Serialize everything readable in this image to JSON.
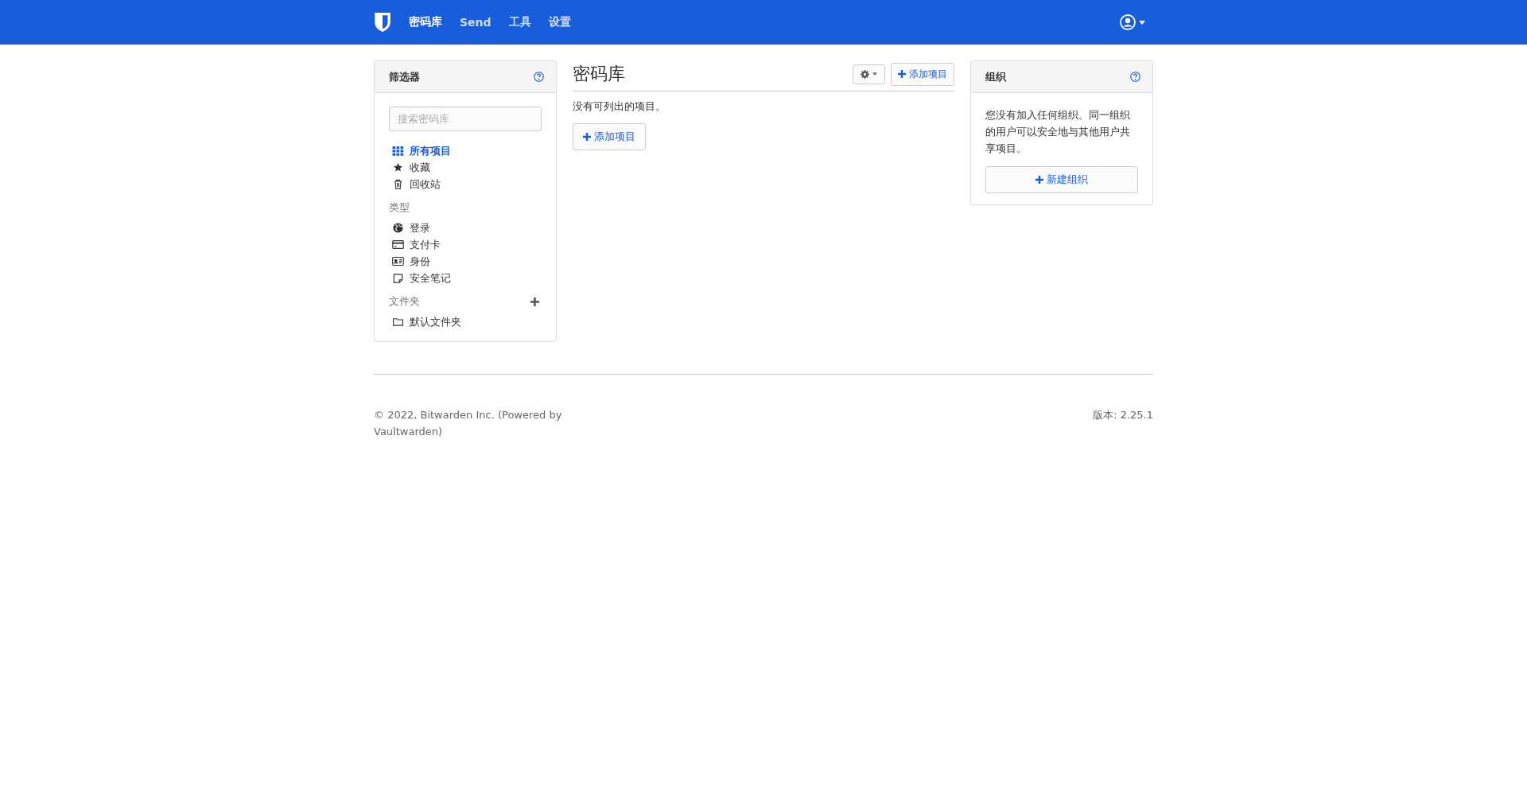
{
  "navbar": {
    "links": [
      {
        "label": "密码库",
        "selected": true
      },
      {
        "label": "Send",
        "selected": false
      },
      {
        "label": "工具",
        "selected": false
      },
      {
        "label": "设置",
        "selected": false
      }
    ]
  },
  "filters": {
    "title": "筛选器",
    "search": {
      "placeholder": "搜索密码库"
    },
    "items": [
      {
        "label": "所有项目",
        "kind": "grid",
        "selected": true
      },
      {
        "label": "收藏",
        "kind": "star",
        "selected": false
      },
      {
        "label": "回收站",
        "kind": "trash",
        "selected": false
      }
    ],
    "types_heading": "类型",
    "types": [
      {
        "label": "登录",
        "kind": "globe",
        "selected": false
      },
      {
        "label": "支付卡",
        "kind": "card",
        "selected": false
      },
      {
        "label": "身份",
        "kind": "id",
        "selected": false
      },
      {
        "label": "安全笔记",
        "kind": "note",
        "selected": false
      }
    ],
    "folders_heading": "文件夹",
    "folders": [
      {
        "label": "默认文件夹",
        "selected": false
      }
    ]
  },
  "vault": {
    "title": "密码库",
    "add_button": "添加项目",
    "empty_message": "没有可列出的项目。",
    "empty_add_button": "添加项目"
  },
  "organizations": {
    "title": "组织",
    "message": "您没有加入任何组织。同一组织的用户可以安全地与其他用户共享项目。",
    "new_button": "新建组织"
  },
  "footer": {
    "copyright": "© 2022, Bitwarden Inc. (Powered by Vaultwarden)",
    "version": "版本: 2.25.1"
  }
}
